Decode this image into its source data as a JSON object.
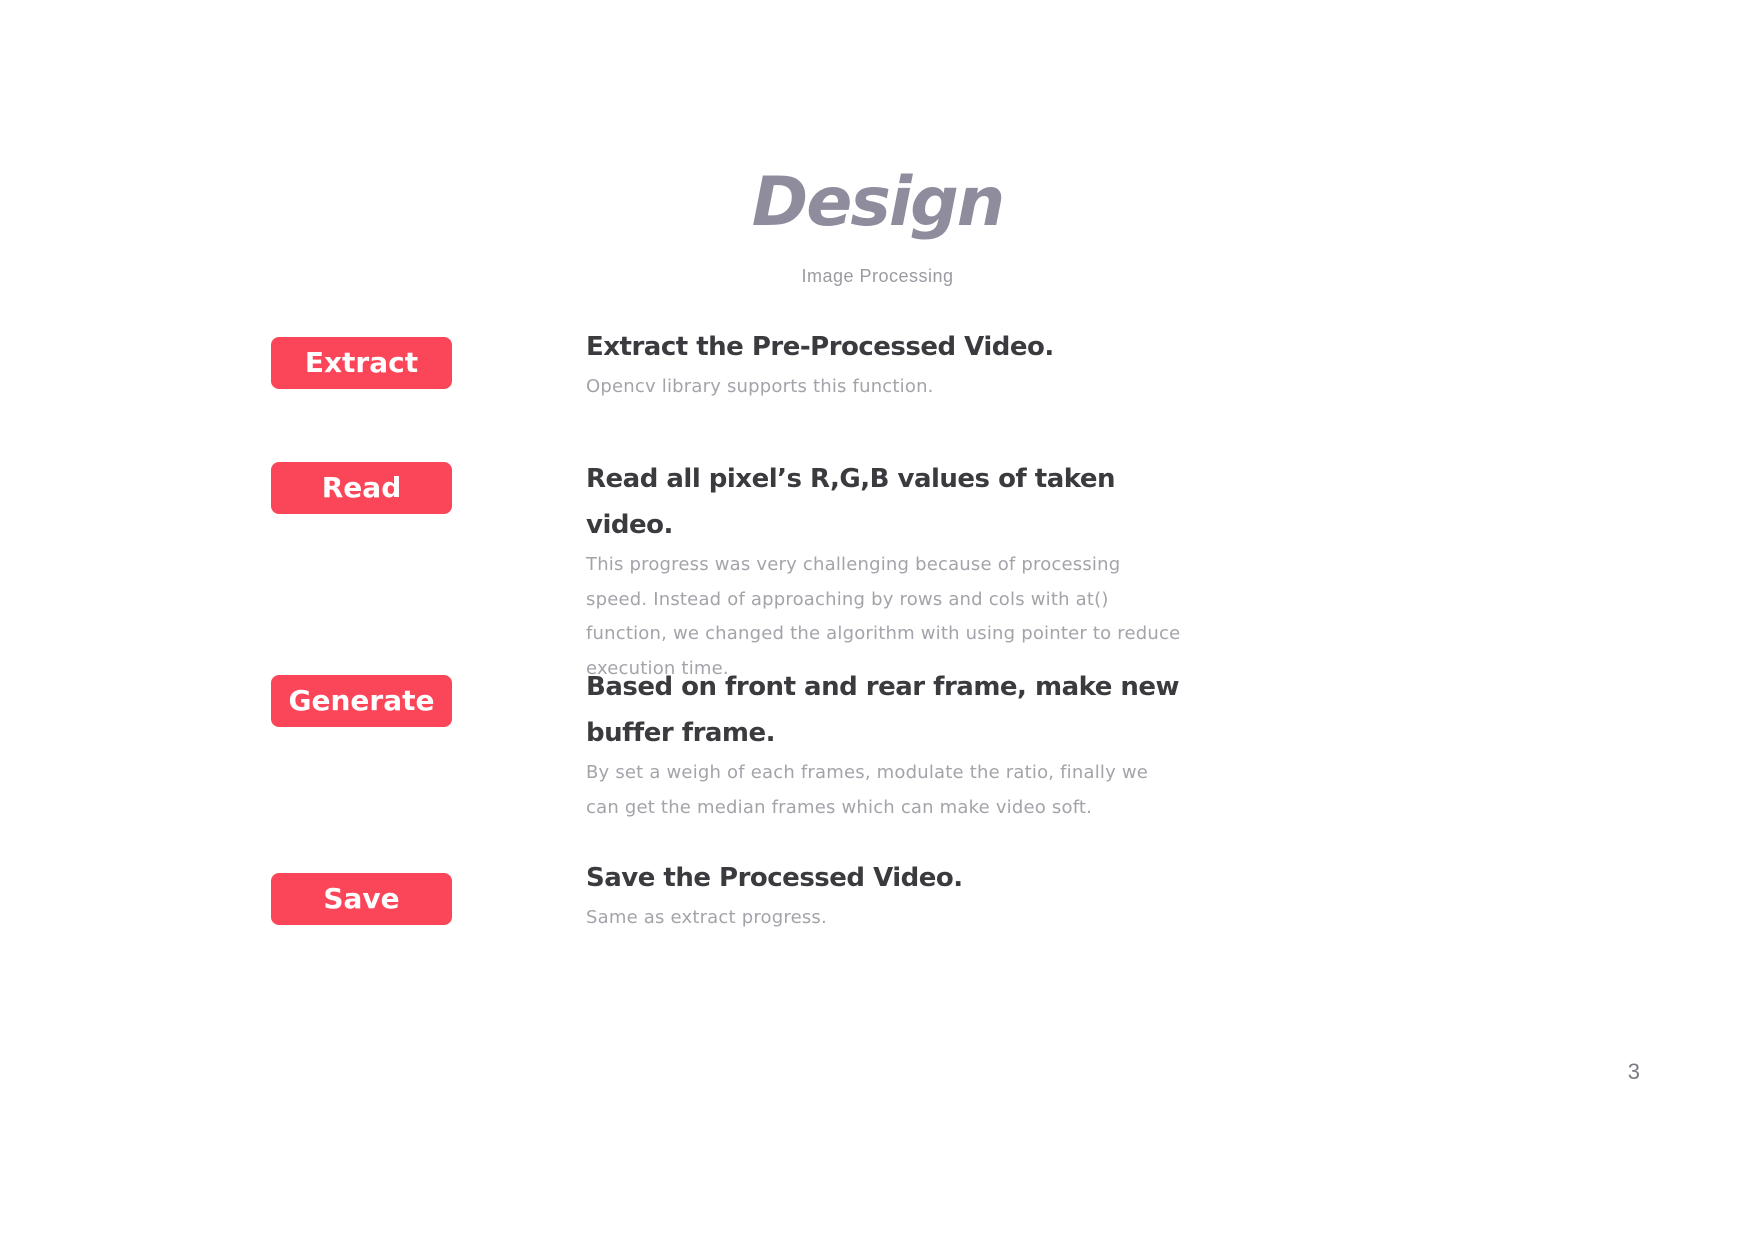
{
  "slide": {
    "title": "Design",
    "subtitle": "Image Processing",
    "page_number": "3"
  },
  "steps": [
    {
      "button": "Extract",
      "heading": "Extract the Pre-Processed Video.",
      "description": "Opencv library supports this function."
    },
    {
      "button": "Read",
      "heading": "Read all pixel’s R,G,B values of taken video.",
      "description": "This progress was very challenging because of processing speed. Instead of approaching by rows and cols with at() function, we changed the algorithm with using pointer to reduce execution time."
    },
    {
      "button": "Generate",
      "heading": "Based on front and rear frame, make new buffer frame.",
      "description": "By set a weigh of each frames, modulate the ratio, finally we can get the median frames which can make video soft."
    },
    {
      "button": "Save",
      "heading": "Save the Processed Video.",
      "description": "Same as extract progress."
    }
  ],
  "colors": {
    "accent": "#fb4659",
    "title": "#8f8d9d",
    "heading": "#3b3b3f",
    "body_text": "#a3a3aa"
  }
}
